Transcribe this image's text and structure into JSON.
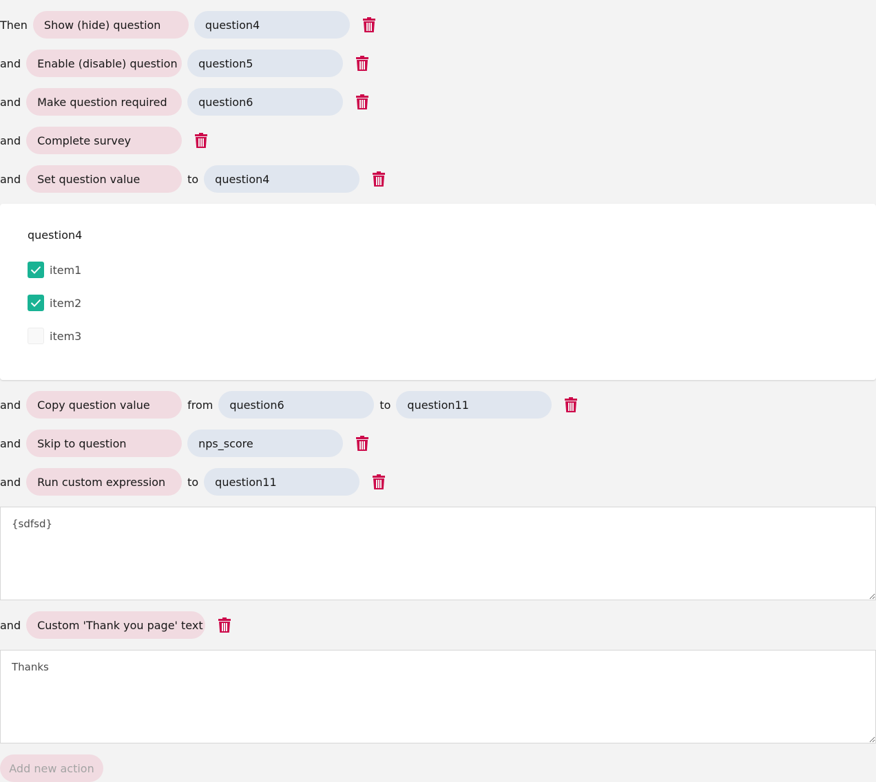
{
  "colors": {
    "accent": "#cd0a4b",
    "check": "#19b394",
    "action_bg": "#f1dbe1",
    "target_bg": "#e0e6ef"
  },
  "actions": [
    {
      "conj": "Then",
      "type": "Show (hide) question",
      "target": "question4"
    },
    {
      "conj": "and",
      "type": "Enable (disable) question",
      "target": "question5"
    },
    {
      "conj": "and",
      "type": "Make question required",
      "target": "question6"
    },
    {
      "conj": "and",
      "type": "Complete survey"
    },
    {
      "conj": "and",
      "type": "Set question value",
      "to": "to",
      "target": "question4"
    },
    {
      "conj": "and",
      "type": "Copy question value",
      "from": "from",
      "source": "question6",
      "to": "to",
      "target": "question11"
    },
    {
      "conj": "and",
      "type": "Skip to question",
      "target": "nps_score"
    },
    {
      "conj": "and",
      "type": "Run custom expression",
      "to": "to",
      "target": "question11",
      "expression": "{sdfsd}"
    },
    {
      "conj": "and",
      "type": "Custom 'Thank you page' text",
      "text": "Thanks"
    }
  ],
  "value_panel": {
    "title": "question4",
    "items": [
      {
        "label": "item1",
        "checked": true
      },
      {
        "label": "item2",
        "checked": true
      },
      {
        "label": "item3",
        "checked": false
      }
    ]
  },
  "add_button": "Add new action",
  "icons": {
    "delete": "trash-icon",
    "check": "checkmark-icon"
  }
}
